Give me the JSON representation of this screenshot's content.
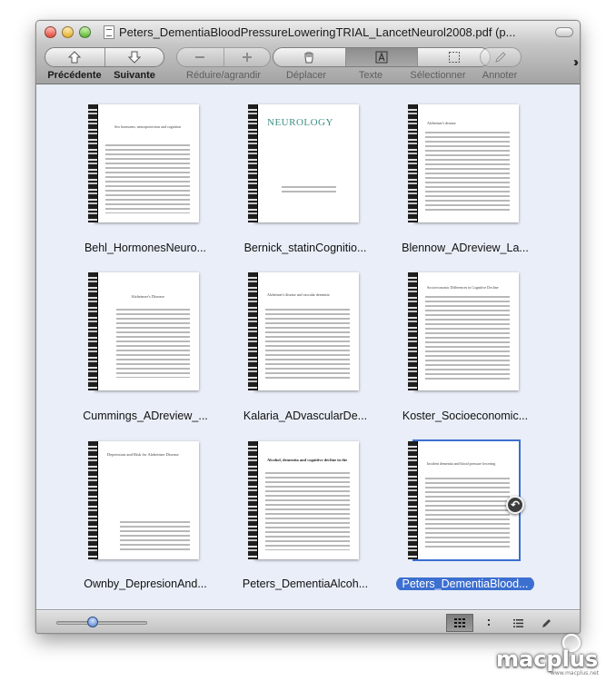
{
  "window": {
    "title": "Peters_DementiaBloodPressureLoweringTRIAL_LancetNeurol2008.pdf (p..."
  },
  "toolbar": {
    "prev_label": "Précédente",
    "next_label": "Suivante",
    "zoom_label": "Réduire/agrandir",
    "move_label": "Déplacer",
    "text_label": "Texte",
    "select_label": "Sélectionner",
    "annotate_label": "Annoter",
    "overflow_icon": "double-chevron-icon"
  },
  "documents": [
    {
      "label": "Behl_HormonesNeuro...",
      "heading": "Sex hormones, neuroprotection and cognition",
      "journal": ""
    },
    {
      "label": "Bernick_statinCognitio...",
      "heading": "",
      "journal": "NEUROLOGY"
    },
    {
      "label": "Blennow_ADreview_La...",
      "heading": "Alzheimer's disease",
      "journal": ""
    },
    {
      "label": "Cummings_ADreview_...",
      "heading": "Alzheimer's Disease",
      "journal": ""
    },
    {
      "label": "Kalaria_ADvascularDe...",
      "heading": "Alzheimer's disease and vascular dementia",
      "journal": ""
    },
    {
      "label": "Koster_Socioeconomic...",
      "heading": "Socioeconomic Differences in Cognitive Decline",
      "journal": ""
    },
    {
      "label": "Ownby_DepresionAnd...",
      "heading": "Depression and Risk for Alzheimer Disease",
      "journal": ""
    },
    {
      "label": "Peters_DementiaAlcoh...",
      "heading": "Alcohol, dementia and cognitive decline in the elderly",
      "journal": ""
    },
    {
      "label": "Peters_DementiaBlood...",
      "heading": "Incident dementia and blood pressure lowering",
      "journal": ""
    }
  ],
  "selected_index": 8,
  "zoom_slider": {
    "value": 0.4
  },
  "view_modes": [
    "grid-view-icon",
    "single-page-icon",
    "list-view-icon",
    "annotate-pen-icon"
  ],
  "selected_view": 0,
  "watermark": {
    "brand": "macplus",
    "url": "www.macplus.net"
  },
  "colors": {
    "selection": "#3c6fd0",
    "content_bg": "#e9eef8"
  }
}
